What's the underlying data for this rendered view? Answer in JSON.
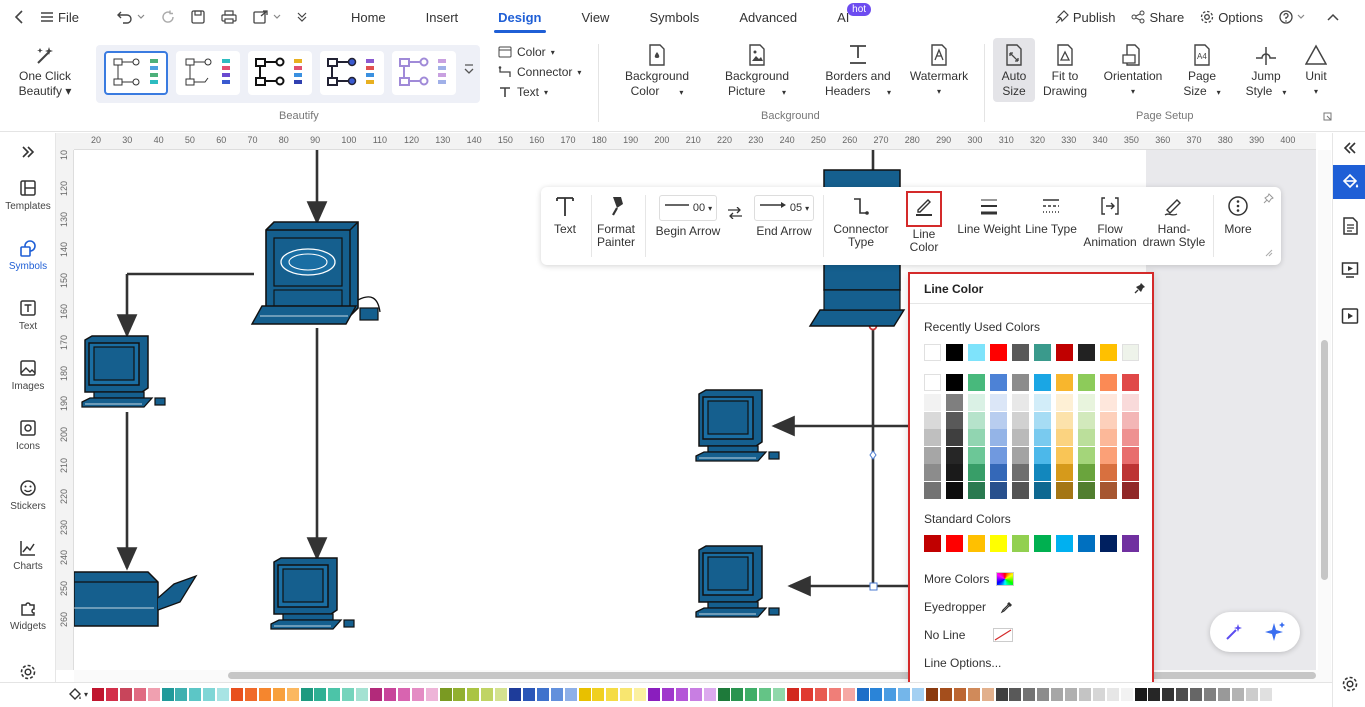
{
  "topbar": {
    "file": "File",
    "tabs": [
      "Home",
      "Insert",
      "Design",
      "View",
      "Symbols",
      "Advanced",
      "AI"
    ],
    "active_tab": "Design",
    "hot_badge": "hot",
    "publish": "Publish",
    "share": "Share",
    "options": "Options"
  },
  "ribbon": {
    "one_click": [
      "One Click",
      "Beautify"
    ],
    "beautify_label": "Beautify",
    "color": "Color",
    "connector": "Connector",
    "text": "Text",
    "background_color": [
      "Background",
      "Color"
    ],
    "background_picture": [
      "Background",
      "Picture"
    ],
    "borders_headers": [
      "Borders and",
      "Headers"
    ],
    "watermark": "Watermark",
    "background_label": "Background",
    "auto_size": [
      "Auto",
      "Size"
    ],
    "fit_to_drawing": [
      "Fit to",
      "Drawing"
    ],
    "orientation": "Orientation",
    "page_size": [
      "Page",
      "Size"
    ],
    "jump_style": [
      "Jump",
      "Style"
    ],
    "unit": "Unit",
    "page_setup_label": "Page Setup"
  },
  "sidebar": {
    "items": [
      {
        "label": "Templates",
        "icon": "templates-icon"
      },
      {
        "label": "Symbols",
        "icon": "symbols-icon"
      },
      {
        "label": "Text",
        "icon": "text-icon"
      },
      {
        "label": "Images",
        "icon": "images-icon"
      },
      {
        "label": "Icons",
        "icon": "icons-icon"
      },
      {
        "label": "Stickers",
        "icon": "stickers-icon"
      },
      {
        "label": "Charts",
        "icon": "charts-icon"
      },
      {
        "label": "Widgets",
        "icon": "widgets-icon"
      }
    ],
    "selected": "Symbols"
  },
  "ruler": {
    "top": [
      "20",
      "30",
      "40",
      "50",
      "60",
      "70",
      "80",
      "90",
      "100",
      "110",
      "120",
      "130",
      "140",
      "150",
      "160",
      "170",
      "180",
      "190",
      "200",
      "210",
      "220",
      "230",
      "240",
      "250",
      "260",
      "270",
      "280",
      "290",
      "300",
      "310",
      "320",
      "330",
      "340",
      "350",
      "360",
      "370",
      "380",
      "390",
      "400"
    ],
    "left": [
      "10",
      "120",
      "130",
      "140",
      "150",
      "160",
      "170",
      "180",
      "190",
      "200",
      "210",
      "220",
      "230",
      "240",
      "250",
      "260"
    ]
  },
  "float_toolbar": {
    "text": "Text",
    "format_painter": [
      "Format",
      "Painter"
    ],
    "begin_arrow_value": "00",
    "begin_arrow": "Begin Arrow",
    "end_arrow_value": "05",
    "end_arrow": "End Arrow",
    "connector_type": [
      "Connector",
      "Type"
    ],
    "line_color": "Line Color",
    "line_weight": "Line Weight",
    "line_type": "Line Type",
    "flow_animation": [
      "Flow",
      "Animation"
    ],
    "hand_drawn": [
      "Hand-",
      "drawn Style"
    ],
    "more": "More"
  },
  "line_color_popover": {
    "title": "Line Color",
    "recent_label": "Recently Used Colors",
    "recent_colors": [
      "#ffffff",
      "#000000",
      "#7ee3fb",
      "#ff0000",
      "#595959",
      "#3a9a8c",
      "#c00000",
      "#222222",
      "#ffc000",
      "#eef3ea"
    ],
    "theme_top": [
      "#ffffff",
      "#000000",
      "#48b97c",
      "#4d82d6",
      "#8c8c8c",
      "#1aa6e4",
      "#f8b62d",
      "#8dcb5a",
      "#fb8a55",
      "#e04848"
    ],
    "theme_shades": [
      [
        "#f2f2f2",
        "#7f7f7f",
        "#daf1e5",
        "#dbe6f7",
        "#e8e8e8",
        "#d2edf9",
        "#fef0d5",
        "#e8f4dd",
        "#fee7dc",
        "#f9dada"
      ],
      [
        "#d9d9d9",
        "#595959",
        "#b6e3cb",
        "#b8cdef",
        "#d1d1d1",
        "#a6dcf4",
        "#fce2ab",
        "#d2e9bc",
        "#fdd0bb",
        "#f3b6b6"
      ],
      [
        "#bfbfbf",
        "#3f3f3f",
        "#91d5b1",
        "#94b4e7",
        "#bababa",
        "#79caef",
        "#fbd380",
        "#bbdf9b",
        "#fcb899",
        "#ee9191"
      ],
      [
        "#a6a6a6",
        "#262626",
        "#6cc797",
        "#7099df",
        "#a3a3a3",
        "#4cb8ea",
        "#f9c556",
        "#a4d57a",
        "#fba077",
        "#e86d6d"
      ],
      [
        "#8c8c8c",
        "#1a1a1a",
        "#389e68",
        "#3468b8",
        "#6e6e6e",
        "#1287bd",
        "#d69a1b",
        "#6aa43d",
        "#d8703f",
        "#bd3434"
      ],
      [
        "#737373",
        "#0d0d0d",
        "#2a7a50",
        "#28508d",
        "#545454",
        "#0e6891",
        "#a47615",
        "#517e2f",
        "#a65630",
        "#912828"
      ]
    ],
    "standard_label": "Standard Colors",
    "standard_colors": [
      "#c00000",
      "#ff0000",
      "#ffc000",
      "#ffff00",
      "#92d050",
      "#00b050",
      "#00b0f0",
      "#0070c0",
      "#002060",
      "#7030a0"
    ],
    "more_colors": "More Colors",
    "eyedropper": "Eyedropper",
    "no_line": "No Line",
    "line_options": "Line Options..."
  },
  "palette_colors": [
    "#c0152e",
    "#d32f4a",
    "#c8455b",
    "#e06b82",
    "#f0a0b0",
    "#209a9a",
    "#3fb0b0",
    "#5cc6c6",
    "#7fd6d6",
    "#a8e4e4",
    "#e8501e",
    "#f06a2a",
    "#f5862e",
    "#f8a03c",
    "#fbb860",
    "#1e9a80",
    "#2fb094",
    "#4cc4a8",
    "#76d4bc",
    "#a4e2d2",
    "#b22a7a",
    "#c8449a",
    "#d864b0",
    "#e48cc4",
    "#eeb4d8",
    "#7a9a22",
    "#92b030",
    "#aac443",
    "#c0d464",
    "#d4e290",
    "#1e3c9a",
    "#2a56b8",
    "#3f72cc",
    "#6290dc",
    "#8eb0e8",
    "#e8c000",
    "#f0d020",
    "#f5dc44",
    "#f8e670",
    "#fbf0a0",
    "#8a1ebe",
    "#a038cc",
    "#b456d8",
    "#c87ee2",
    "#dcaaee",
    "#1e7a3a",
    "#2a9450",
    "#3fae68",
    "#64c486",
    "#90d8aa",
    "#d2281e",
    "#e03a30",
    "#e85a50",
    "#f07e78",
    "#f6a8a4",
    "#1e6ec8",
    "#2a84d8",
    "#4a9ce2",
    "#74b6ea",
    "#a4d0f2",
    "#8a3a0e",
    "#a44e1c",
    "#bc6632",
    "#d08a5a",
    "#e2b08c",
    "#404040",
    "#595959",
    "#737373",
    "#8c8c8c",
    "#a6a6a6",
    "#b0b0b0",
    "#c4c4c4",
    "#d6d6d6",
    "#e6e6e6",
    "#f2f2f2",
    "#1a1a1a",
    "#262626",
    "#333333",
    "#4d4d4d",
    "#666666",
    "#808080",
    "#999999",
    "#b3b3b3",
    "#cccccc",
    "#e0e0e0"
  ]
}
